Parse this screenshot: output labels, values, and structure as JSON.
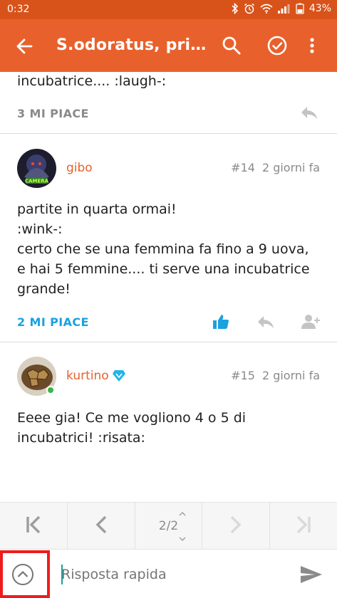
{
  "status_bar": {
    "time": "0:32",
    "battery": "43%",
    "icons": [
      "bluetooth-icon",
      "alarm-icon",
      "wifi-icon",
      "signal-icon",
      "battery-icon"
    ]
  },
  "app_bar": {
    "title": "S.odoratus, pri…",
    "actions": [
      "back-arrow-icon",
      "search-icon",
      "check-circle-icon",
      "more-vert-icon"
    ]
  },
  "previous_post": {
    "text_tail": "incubatrice.... :laugh-:",
    "likes_label": "3 MI PIACE"
  },
  "posts": [
    {
      "author": "gibo",
      "number": "#14",
      "time": "2 giorni fa",
      "text": "partite in quarta ormai!\n:wink-:\ncerto che se una femmina fa fino a 9 uova,\ne hai 5 femmine.... ti serve una incubatrice\ngrande!",
      "likes_label": "2 MI PIACE",
      "avatar_text": "CAMERA"
    },
    {
      "author": "kurtino",
      "number": "#15",
      "time": "2 giorni fa",
      "text": "Eeee gia! Ce me vogliono 4 o 5 di\nincubatrici! :risata:",
      "likes_label": ""
    }
  ],
  "pager": {
    "page": "2",
    "total": "2"
  },
  "reply": {
    "placeholder": "Risposta rapida"
  },
  "colors": {
    "status_bar": "#d8531a",
    "app_bar": "#e8612c",
    "author": "#e8612c",
    "liked": "#1aa1e0",
    "highlight_box": "#ee1c1c"
  }
}
